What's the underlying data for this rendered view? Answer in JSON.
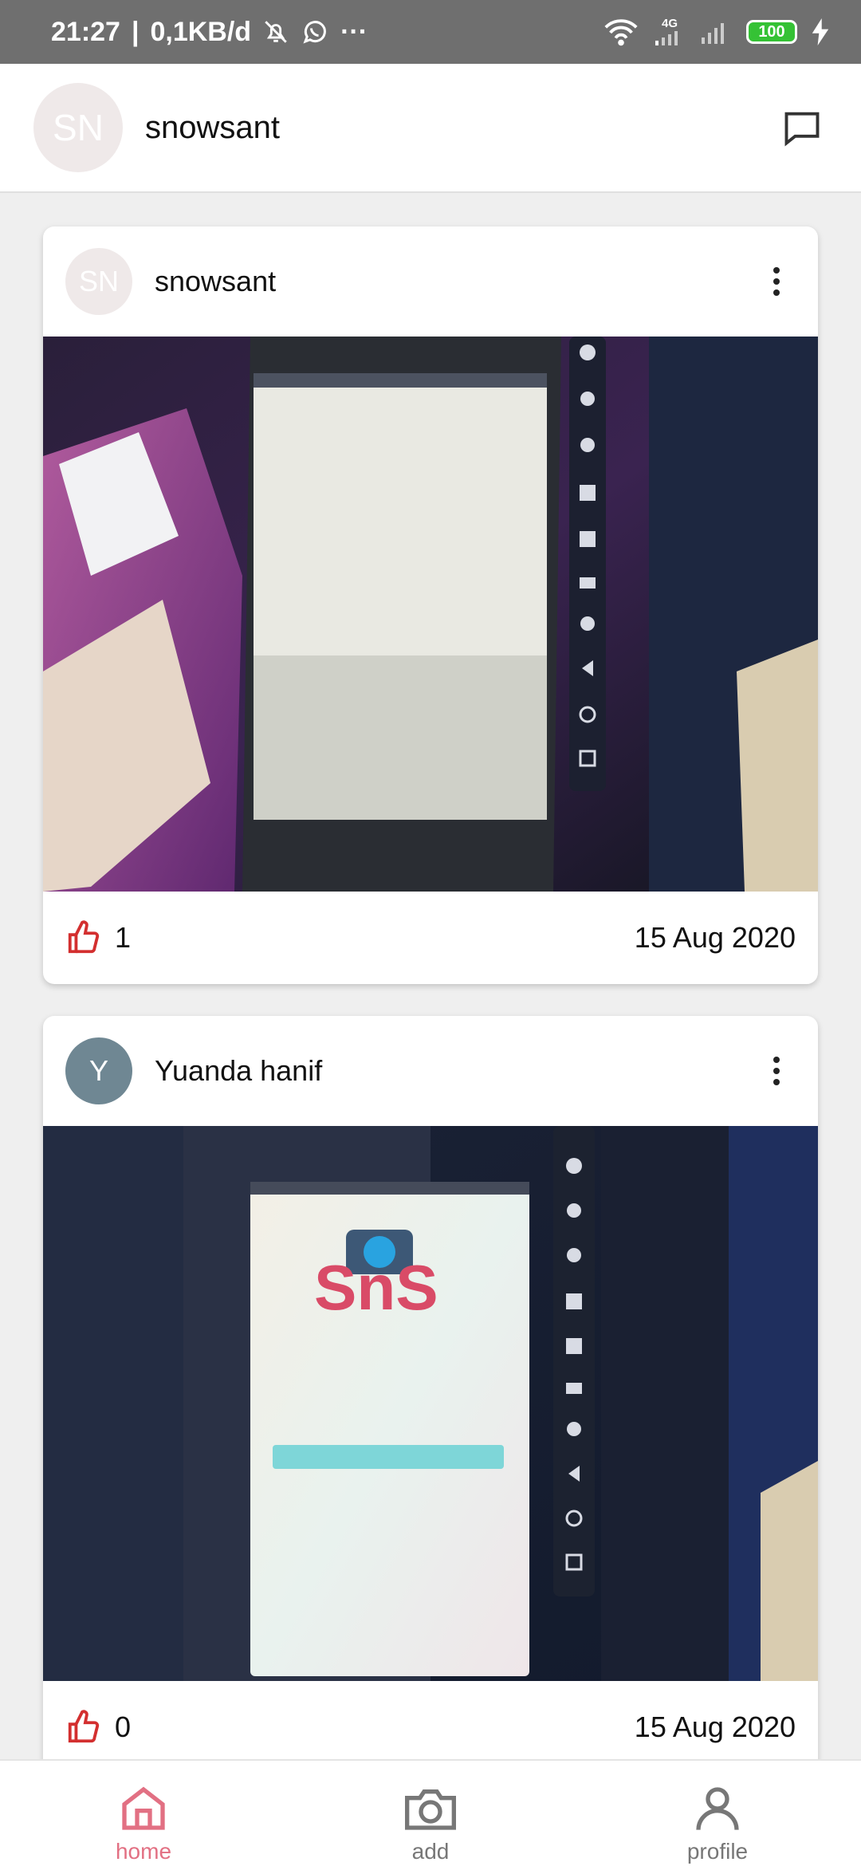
{
  "status_bar": {
    "time": "21:27",
    "network_speed": "0,1KB/d",
    "more": "···",
    "network_type": "4G",
    "battery": "100"
  },
  "header": {
    "avatar_initials": "SN",
    "username": "snowsant"
  },
  "posts": [
    {
      "avatar_initials": "SN",
      "avatar_color": "#efe9e9",
      "username": "snowsant",
      "likes": "1",
      "date": "15 Aug 2020"
    },
    {
      "avatar_initials": "Y",
      "avatar_color": "#6f8793",
      "username": "Yuanda hanif",
      "likes": "0",
      "date": "15 Aug 2020"
    }
  ],
  "nav": {
    "home": "home",
    "add": "add",
    "profile": "profile"
  },
  "colors": {
    "accent": "#e27083",
    "like": "#d32f2f"
  }
}
